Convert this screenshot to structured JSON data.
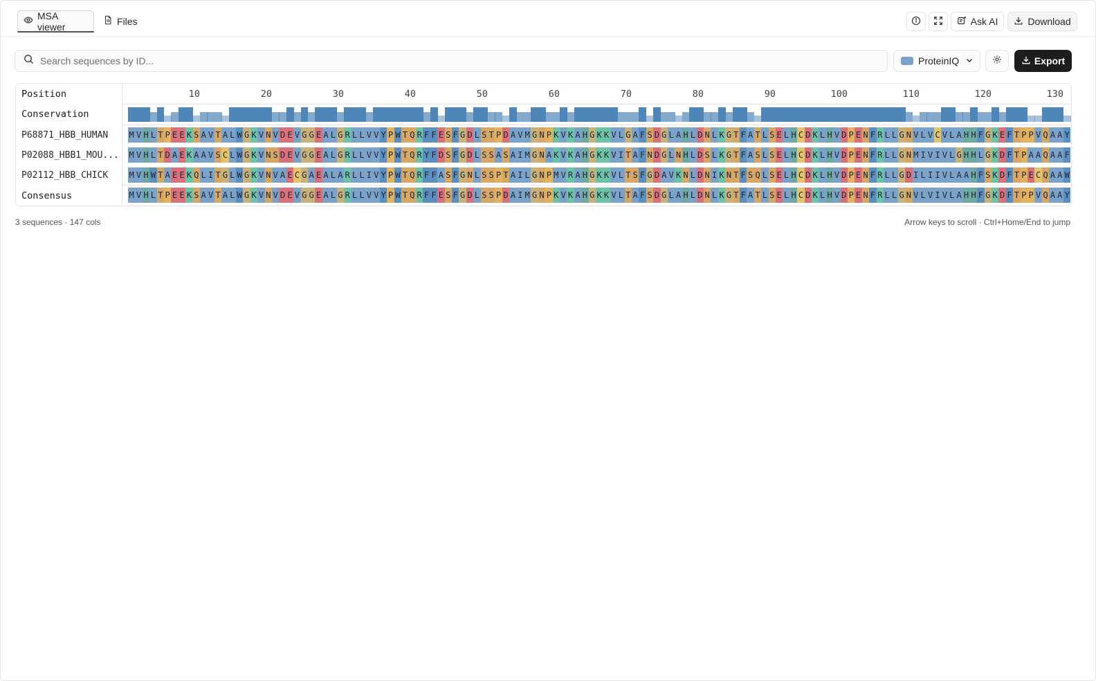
{
  "tabs": [
    {
      "label": "MSA viewer",
      "active": true
    },
    {
      "label": "Files",
      "active": false
    }
  ],
  "actions": {
    "ask_ai_label": "Ask AI",
    "download_label": "Download"
  },
  "toolbar": {
    "search_placeholder": "Search sequences by ID...",
    "color_scheme": "ProteinIQ",
    "export_label": "Export"
  },
  "table": {
    "position_label": "Position",
    "conservation_label": "Conservation",
    "consensus_label": "Consensus",
    "tick_labels": [
      "10",
      "20",
      "30",
      "40",
      "50",
      "60",
      "70",
      "80",
      "90",
      "100",
      "110",
      "120",
      "130"
    ],
    "sequences": [
      {
        "id": "P68871_HBB_HUMAN",
        "display_id": "P68871_HBB_HUMAN",
        "residues": "MVHLTPEEKSAVTALWGKVNVDEVGGEALGRLLVVYPWTQRFFESFGDLSTPDAVMGNPKVKAHGKKVLGAFSDGLAHLDNLKGTFATLSELHCDKLHVDPENFRLLGNVLVCVLAHHFGKEFTPPVQAAY"
      },
      {
        "id": "P02088_HBB1_MOUSE",
        "display_id": "P02088_HBB1_MOU...",
        "residues": "MVHLTDAEKAAVSCLWGKVNSDEVGGEALGRLLVVYPWTQRYFDSFGDLSSASAIMGNAKVKAHGKKVITAFNDGLNHLDSLKGTFASLSELHCDKLHVDPENFRLLGNMIVIVLGHHLGKDFTPAAQAAF"
      },
      {
        "id": "P02112_HBB_CHICK",
        "display_id": "P02112_HBB_CHICK",
        "residues": "MVHWTAEEKQLITGLWGKVNVAECGAEALARLLIVYPWTQRFFASFGNLSSPTAILGNPMVRAHGKKVLTSFGDAVKNLDNIKNTFSQLSELHCDKLHVDPENFRLLGDILIIVLAAHFSKDFTPECQAAW"
      }
    ],
    "consensus": "MVHLTPEEKSAVTALWGKVNVDEVGGEALGRLLVVYPWTQRFFESFGDLSSPDAIMGNPKVKAHGKKVLTAFSDGLAHLDNLKGTFATLSELHCDKLHVDPENFRLLGNVLVIVLAHHFGKDFTPPVQAAY"
  },
  "colors": {
    "hydrophobic": "#7ba3c9",
    "aromatic": "#5a8fbf",
    "positive": "#6cc3a6",
    "negative": "#d9707a",
    "polar": "#d7a766",
    "special_g": "#c9b27a",
    "special_p": "#e2b25e",
    "cysteine": "#e4c46a",
    "histidine": "#6ea9a4",
    "conservation": "#4f86b8"
  },
  "footer": {
    "summary": "3 sequences · 147 cols",
    "hint": "Arrow keys to scroll · Ctrl+Home/End to jump"
  }
}
